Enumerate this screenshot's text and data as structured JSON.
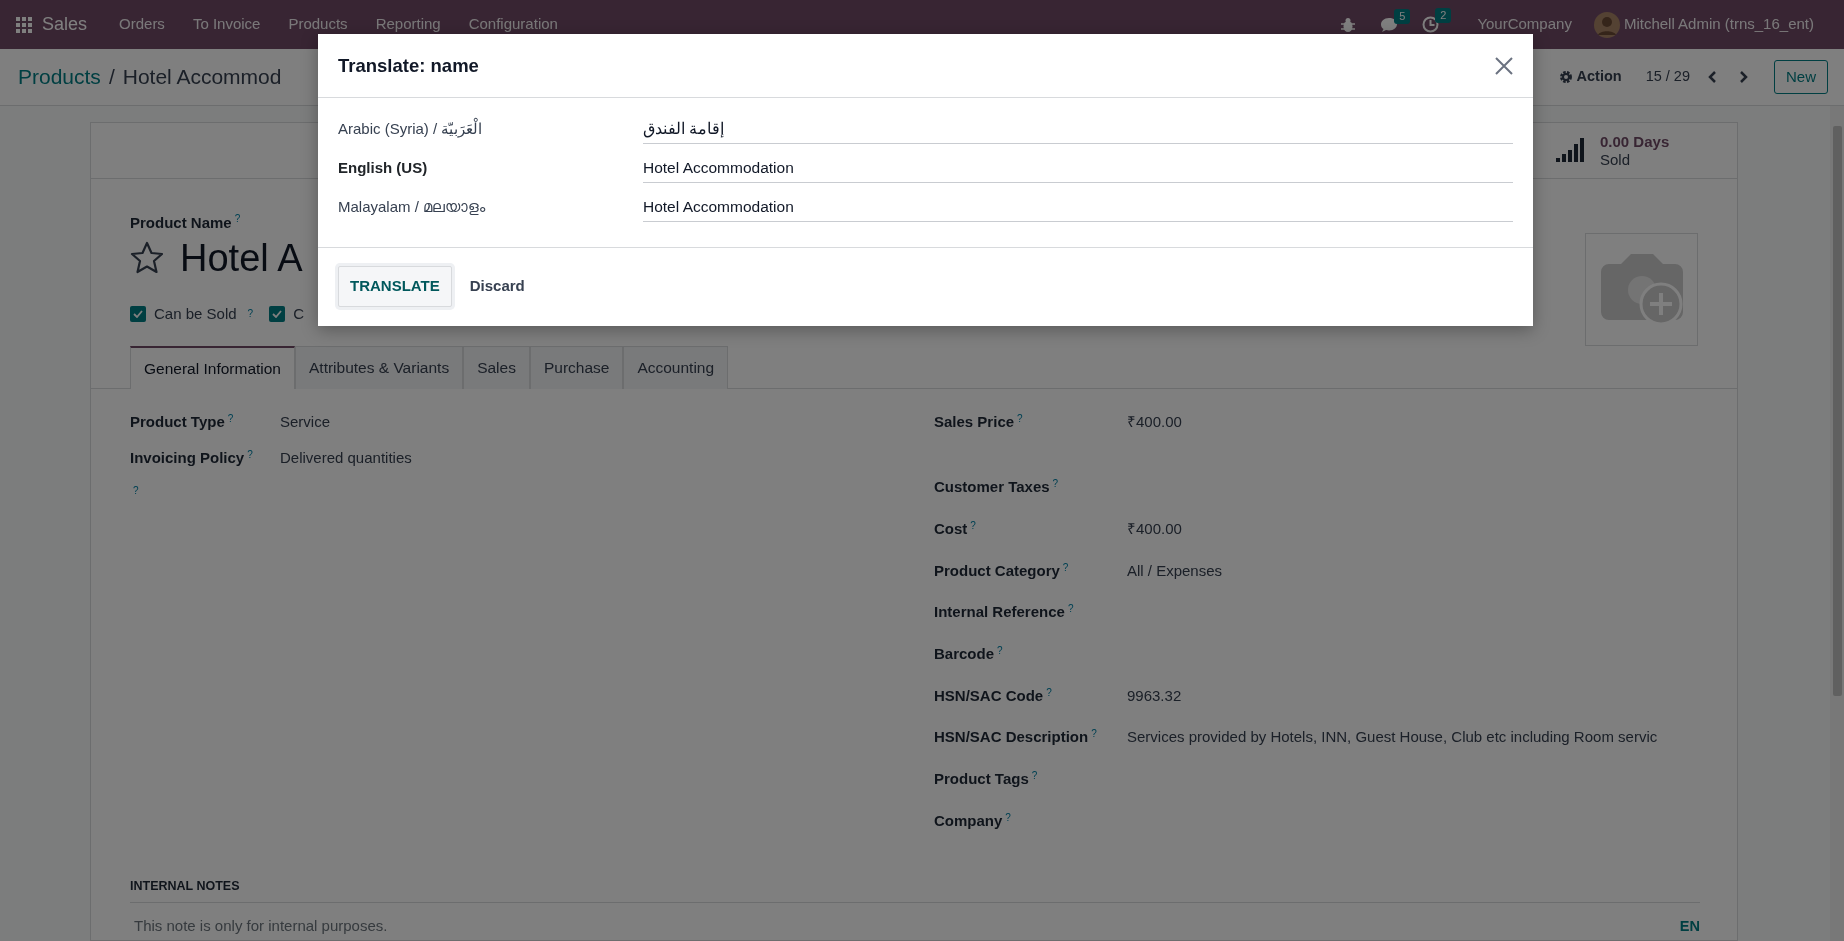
{
  "navbar": {
    "app": "Sales",
    "menus": [
      "Orders",
      "To Invoice",
      "Products",
      "Reporting",
      "Configuration"
    ],
    "chat_count": "5",
    "activity_count": "2",
    "company": "YourCompany",
    "user": "Mitchell Admin (trns_16_ent)"
  },
  "breadcrumb": [
    {
      "label": "Products",
      "kind": "link"
    },
    {
      "separator": "/",
      "label": "Hotel Accommod",
      "kind": "current"
    }
  ],
  "control_panel": {
    "action": "Action",
    "pager": "15 / 29",
    "new_button": "New"
  },
  "stat_button": {
    "value": "0.00 Days",
    "label": "Sold"
  },
  "product": {
    "name_label": "Product Name",
    "help": "?",
    "name": "Hotel A",
    "starred": false
  },
  "checkboxes": [
    {
      "label": "Can be Sold",
      "help": "?",
      "checked": true
    },
    {
      "label": "C",
      "checked": true
    }
  ],
  "tabs": [
    {
      "label": "General Information",
      "selected": true
    },
    {
      "label": "Attributes & Variants",
      "selected": false
    },
    {
      "label": "Sales",
      "selected": false
    },
    {
      "label": "Purchase",
      "selected": false
    },
    {
      "label": "Accounting",
      "selected": false
    }
  ],
  "left_fields": [
    {
      "label": "Product Type",
      "help": "?",
      "value": "Service"
    },
    {
      "label": "Invoicing Policy",
      "help": "?",
      "value": "Delivered quantities"
    },
    {
      "help": "?"
    }
  ],
  "right_fields": [
    {
      "label": "Sales Price",
      "help": "?",
      "value": "₹400.00"
    },
    {
      "label": "Customer Taxes",
      "help": "?"
    },
    {
      "label": "Cost",
      "help": "?",
      "value": "₹400.00"
    },
    {
      "label": "Product Category",
      "help": "?",
      "value": "All / Expenses"
    },
    {
      "label": "Internal Reference",
      "help": "?"
    },
    {
      "label": "Barcode",
      "help": "?"
    },
    {
      "label": "HSN/SAC Code",
      "help": "?",
      "value": "9963.32"
    },
    {
      "label": "HSN/SAC Description",
      "help": "?",
      "value": "Services provided by Hotels, INN, Guest House, Club etc including Room servic"
    },
    {
      "label": "Product Tags",
      "help": "?"
    },
    {
      "label": "Company",
      "help": "?"
    }
  ],
  "internal_notes": {
    "title": "INTERNAL NOTES",
    "placeholder": "This note is only for internal purposes.",
    "language": "EN"
  },
  "dialog": {
    "title": "Translate: name",
    "rows": [
      {
        "language": "Arabic (Syria) / الْعَرَبيّة",
        "value": "إقامة الفندق",
        "current": false
      },
      {
        "language": "English (US)",
        "value": "Hotel Accommodation",
        "current": true
      },
      {
        "language": "Malayalam / മലയാളം",
        "value": "Hotel Accommodation",
        "current": false
      }
    ],
    "buttons": [
      {
        "label": "TRANSLATE",
        "kind": "primary"
      },
      {
        "label": "Discard",
        "kind": "secondary"
      }
    ]
  }
}
